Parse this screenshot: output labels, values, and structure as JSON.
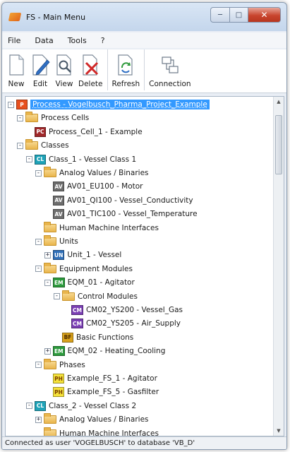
{
  "window": {
    "title": "FS - Main Menu"
  },
  "window_buttons": {
    "minimize": "─",
    "maximize": "□",
    "close": "✕"
  },
  "menu": [
    {
      "label": "File"
    },
    {
      "label": "Data"
    },
    {
      "label": "Tools"
    },
    {
      "label": "?"
    }
  ],
  "toolbar": [
    {
      "label": "New",
      "icon": "new-document-icon"
    },
    {
      "label": "Edit",
      "icon": "edit-pencil-icon"
    },
    {
      "label": "View",
      "icon": "view-magnifier-icon"
    },
    {
      "label": "Delete",
      "icon": "delete-x-icon"
    },
    {
      "label": "Refresh",
      "icon": "refresh-icon"
    },
    {
      "label": "Connection",
      "icon": "connection-icon"
    }
  ],
  "tree": [
    {
      "label": "Process - Vogelbusch_Pharma_Project_Example",
      "badge": "P",
      "exp": "-",
      "level": 0,
      "selected": true
    },
    {
      "label": "Process Cells",
      "folder": true,
      "exp": "-",
      "level": 1
    },
    {
      "label": "Process_Cell_1 - Example",
      "badge": "PC",
      "exp": "",
      "level": 2
    },
    {
      "label": "Classes",
      "folder": true,
      "exp": "-",
      "level": 1
    },
    {
      "label": "Class_1 - Vessel Class 1",
      "badge": "CL",
      "exp": "-",
      "level": 2
    },
    {
      "label": "Analog Values / Binaries",
      "folder": true,
      "exp": "-",
      "level": 3
    },
    {
      "label": "AV01_EU100 - Motor",
      "badge": "AV",
      "exp": "",
      "level": 4
    },
    {
      "label": "AV01_QI100 - Vessel_Conductivity",
      "badge": "AV",
      "exp": "",
      "level": 4
    },
    {
      "label": "AV01_TIC100 - Vessel_Temperature",
      "badge": "AV",
      "exp": "",
      "level": 4
    },
    {
      "label": "Human Machine Interfaces",
      "folder": true,
      "exp": "",
      "level": 3
    },
    {
      "label": "Units",
      "folder": true,
      "exp": "-",
      "level": 3
    },
    {
      "label": "Unit_1 - Vessel",
      "badge": "UN",
      "exp": "+",
      "level": 4
    },
    {
      "label": "Equipment Modules",
      "folder": true,
      "exp": "-",
      "level": 3
    },
    {
      "label": "EQM_01 - Agitator",
      "badge": "EM",
      "exp": "-",
      "level": 4
    },
    {
      "label": "Control Modules",
      "folder": true,
      "exp": "-",
      "level": 5
    },
    {
      "label": "CM02_YS200 - Vessel_Gas",
      "badge": "CM",
      "exp": "",
      "level": 6
    },
    {
      "label": "CM02_YS205 - Air_Supply",
      "badge": "CM",
      "exp": "",
      "level": 6
    },
    {
      "label": "Basic Functions",
      "badge": "BF",
      "exp": "",
      "level": 5
    },
    {
      "label": "EQM_02 - Heating_Cooling",
      "badge": "EM",
      "exp": "+",
      "level": 4
    },
    {
      "label": "Phases",
      "folder": true,
      "exp": "-",
      "level": 3
    },
    {
      "label": "Example_FS_1 - Agitator",
      "badge": "PH",
      "exp": "",
      "level": 4
    },
    {
      "label": "Example_FS_5 - Gasfilter",
      "badge": "PH",
      "exp": "",
      "level": 4
    },
    {
      "label": "Class_2 - Vessel Class 2",
      "badge": "CL",
      "exp": "-",
      "level": 2
    },
    {
      "label": "Analog Values / Binaries",
      "folder": true,
      "exp": "+",
      "level": 3
    },
    {
      "label": "Human Machine Interfaces",
      "folder": true,
      "exp": "",
      "level": 3
    }
  ],
  "badge_colors": {
    "P": {
      "bg": "#e8501e",
      "fg": "#ffffff"
    },
    "PC": {
      "bg": "#a0282a",
      "fg": "#ffffff"
    },
    "CL": {
      "bg": "#1fa3b8",
      "fg": "#ffffff"
    },
    "AV": {
      "bg": "#6d6d6d",
      "fg": "#ffffff"
    },
    "UN": {
      "bg": "#2f6fb8",
      "fg": "#ffffff"
    },
    "EM": {
      "bg": "#2c9a3c",
      "fg": "#ffffff"
    },
    "CM": {
      "bg": "#7b3fb4",
      "fg": "#ffffff"
    },
    "BF": {
      "bg": "#d9a21c",
      "fg": "#4a2a00"
    },
    "PH": {
      "bg": "#f5e23a",
      "fg": "#7a3d00"
    }
  },
  "scrollbar": {
    "up": "▲",
    "down": "▼"
  },
  "status": "Connected as user 'VOGELBUSCH' to database 'VB_D'"
}
